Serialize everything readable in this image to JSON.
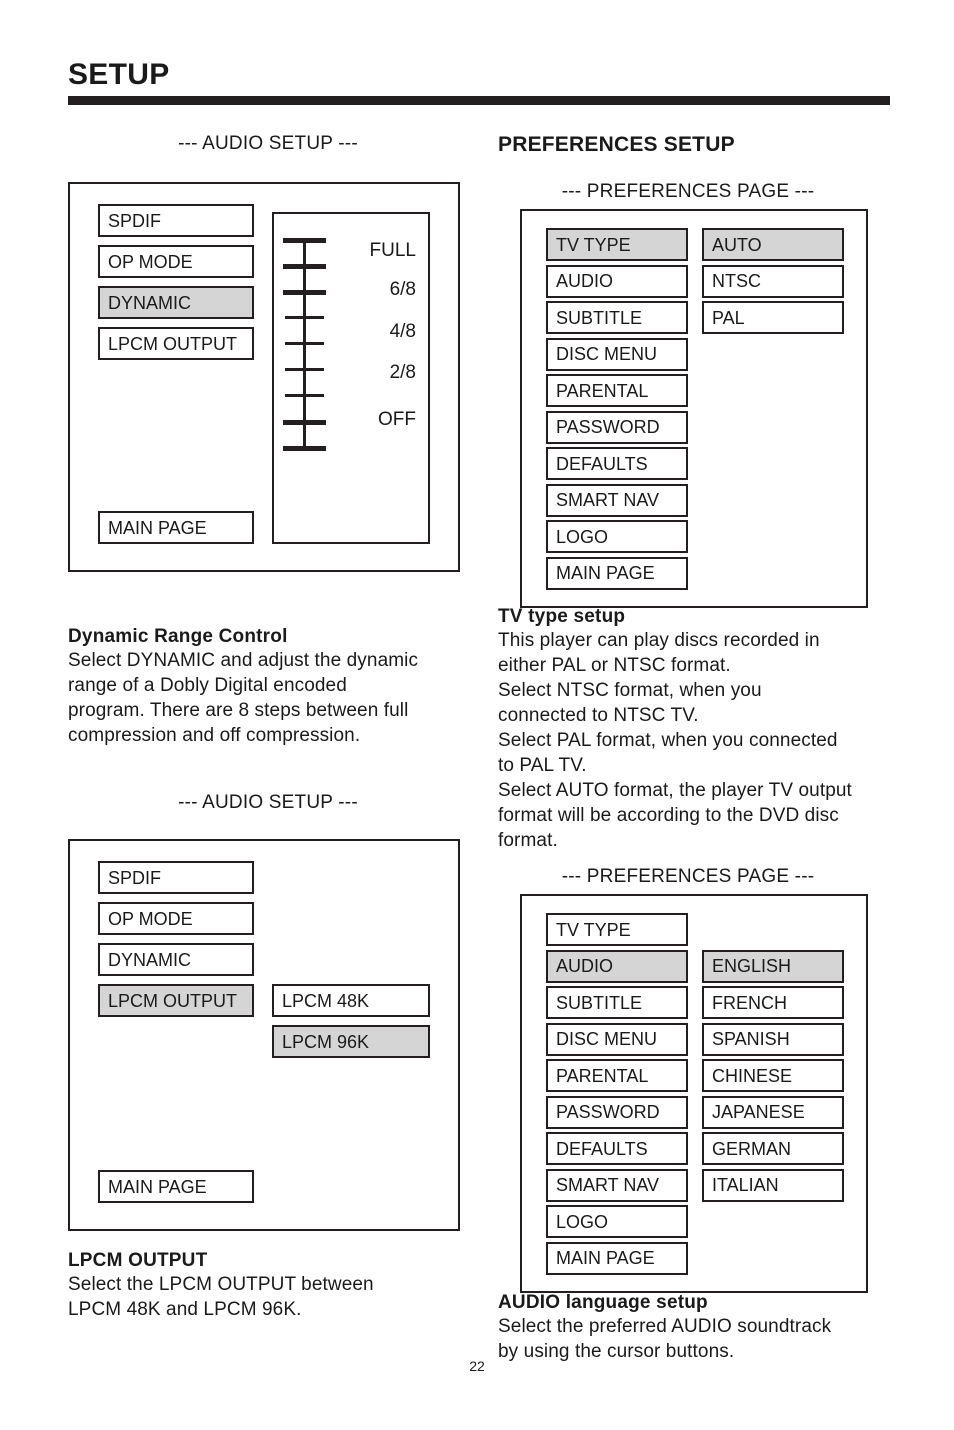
{
  "header": {
    "title": "SETUP"
  },
  "page_number": "22",
  "colors": {
    "rule": "#231f20",
    "highlight": "#d5d5d5",
    "border": "#231f20",
    "text": "#1a1a1a"
  },
  "left_column": {
    "audio_setup_1": {
      "caption": "--- AUDIO SETUP ---",
      "menu": [
        {
          "label": "SPDIF",
          "selected": false
        },
        {
          "label": "OP MODE",
          "selected": false
        },
        {
          "label": "DYNAMIC",
          "selected": true
        },
        {
          "label": "LPCM OUTPUT",
          "selected": false
        }
      ],
      "main_page_label": "MAIN PAGE",
      "scale": {
        "labels": [
          "FULL",
          "6/8",
          "4/8",
          "2/8",
          "OFF"
        ],
        "tick_count": 9,
        "thick_tick_indices": [
          0,
          1,
          2,
          7,
          8
        ]
      }
    },
    "dynamic_range": {
      "heading": "Dynamic Range Control",
      "lines": [
        "Select DYNAMIC and adjust the dynamic",
        "range of a Dobly Digital encoded",
        "program.  There are 8 steps between full",
        "compression and off compression."
      ]
    },
    "audio_setup_2": {
      "caption": "--- AUDIO SETUP ---",
      "menu": [
        {
          "label": "SPDIF",
          "selected": false
        },
        {
          "label": "OP MODE",
          "selected": false
        },
        {
          "label": "DYNAMIC",
          "selected": false
        },
        {
          "label": "LPCM OUTPUT",
          "selected": true
        }
      ],
      "options": [
        {
          "label": "LPCM 48K",
          "selected": false
        },
        {
          "label": "LPCM 96K",
          "selected": true
        }
      ],
      "main_page_label": "MAIN PAGE"
    },
    "lpcm_output": {
      "heading": "LPCM OUTPUT",
      "lines": [
        "Select the LPCM OUTPUT between",
        "LPCM 48K and LPCM 96K."
      ]
    }
  },
  "right_column": {
    "section_title": "PREFERENCES SETUP",
    "prefs_page_1": {
      "caption": "--- PREFERENCES PAGE ---",
      "menu": [
        {
          "label": "TV TYPE",
          "selected": true
        },
        {
          "label": "AUDIO",
          "selected": false
        },
        {
          "label": "SUBTITLE",
          "selected": false
        },
        {
          "label": "DISC MENU",
          "selected": false
        },
        {
          "label": "PARENTAL",
          "selected": false
        },
        {
          "label": "PASSWORD",
          "selected": false
        },
        {
          "label": "DEFAULTS",
          "selected": false
        },
        {
          "label": "SMART NAV",
          "selected": false
        },
        {
          "label": "LOGO",
          "selected": false
        },
        {
          "label": "MAIN PAGE",
          "selected": false
        }
      ],
      "options": [
        {
          "label": "AUTO",
          "selected": true
        },
        {
          "label": "NTSC",
          "selected": false
        },
        {
          "label": "PAL",
          "selected": false
        }
      ]
    },
    "tv_type_setup": {
      "heading": "TV type setup",
      "lines": [
        "This player can play discs recorded in",
        "either PAL or NTSC format.",
        "Select NTSC format, when you",
        "connected to NTSC TV.",
        "Select PAL format, when you connected",
        "to PAL TV.",
        "Select AUTO format, the player TV output",
        "format will be according to the DVD disc",
        "format."
      ]
    },
    "prefs_page_2": {
      "caption": "--- PREFERENCES PAGE ---",
      "menu": [
        {
          "label": "TV TYPE",
          "selected": false
        },
        {
          "label": "AUDIO",
          "selected": true
        },
        {
          "label": "SUBTITLE",
          "selected": false
        },
        {
          "label": "DISC MENU",
          "selected": false
        },
        {
          "label": "PARENTAL",
          "selected": false
        },
        {
          "label": "PASSWORD",
          "selected": false
        },
        {
          "label": "DEFAULTS",
          "selected": false
        },
        {
          "label": "SMART NAV",
          "selected": false
        },
        {
          "label": "LOGO",
          "selected": false
        },
        {
          "label": "MAIN PAGE",
          "selected": false
        }
      ],
      "options": [
        {
          "label": "ENGLISH",
          "selected": true
        },
        {
          "label": "FRENCH",
          "selected": false
        },
        {
          "label": "SPANISH",
          "selected": false
        },
        {
          "label": "CHINESE",
          "selected": false
        },
        {
          "label": "JAPANESE",
          "selected": false
        },
        {
          "label": "GERMAN",
          "selected": false
        },
        {
          "label": "ITALIAN",
          "selected": false
        }
      ]
    },
    "audio_language_setup": {
      "heading": "AUDIO language setup",
      "lines": [
        "Select the preferred AUDIO soundtrack",
        "by using the cursor buttons."
      ]
    }
  }
}
